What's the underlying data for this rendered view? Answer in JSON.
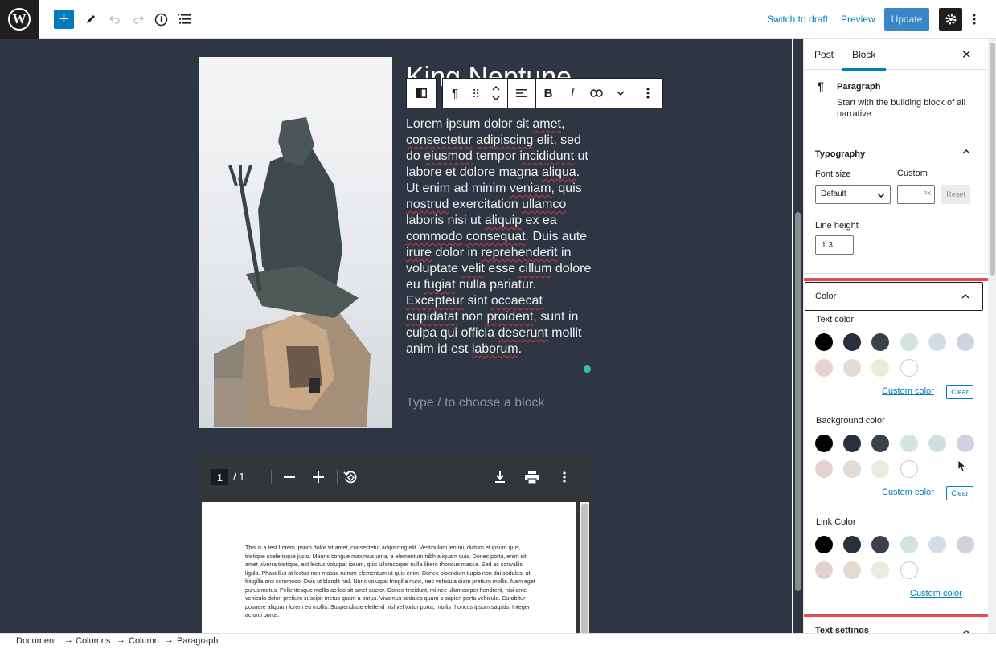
{
  "topbar": {
    "add_glyph": "+",
    "switch_to_draft": "Switch to draft",
    "preview": "Preview",
    "update": "Update"
  },
  "icons": {
    "logo": "wordpress-logo-icon",
    "tools": "pencil-icon",
    "undo": "undo-icon",
    "redo": "redo-icon",
    "details": "info-icon",
    "outline": "list-view-icon",
    "settings": "gear-icon",
    "options": "kebab-icon"
  },
  "editor": {
    "title": "King Neptune",
    "paragraph_parts": [
      {
        "t": "Lorem ipsum dolor sit ",
        "u": false
      },
      {
        "t": "amet",
        "u": true
      },
      {
        "t": ", ",
        "u": false
      },
      {
        "t": "consectetur",
        "u": true
      },
      {
        "t": " ",
        "u": false
      },
      {
        "t": "adipiscing",
        "u": true
      },
      {
        "t": " elit, sed do ",
        "u": false
      },
      {
        "t": "eiusmod",
        "u": true
      },
      {
        "t": " tempor ",
        "u": false
      },
      {
        "t": "incididunt",
        "u": true
      },
      {
        "t": " ut labore et dolore magna ",
        "u": false
      },
      {
        "t": "aliqua",
        "u": true
      },
      {
        "t": ". Ut enim ad minim ",
        "u": false
      },
      {
        "t": "veniam",
        "u": true
      },
      {
        "t": ", quis ",
        "u": false
      },
      {
        "t": "nostrud",
        "u": true
      },
      {
        "t": " exercitation ",
        "u": false
      },
      {
        "t": "ullamco",
        "u": true
      },
      {
        "t": " laboris nisi ut ",
        "u": false
      },
      {
        "t": "aliquip",
        "u": true
      },
      {
        "t": " ex ea ",
        "u": false
      },
      {
        "t": "commodo",
        "u": true
      },
      {
        "t": " ",
        "u": false
      },
      {
        "t": "consequat",
        "u": true
      },
      {
        "t": ". Duis aute ",
        "u": false
      },
      {
        "t": "irure",
        "u": true
      },
      {
        "t": " dolor in ",
        "u": false
      },
      {
        "t": "reprehenderit",
        "u": true
      },
      {
        "t": " in voluptate ",
        "u": false
      },
      {
        "t": "velit",
        "u": true
      },
      {
        "t": " esse ",
        "u": false
      },
      {
        "t": "cillum",
        "u": true
      },
      {
        "t": " dolore eu ",
        "u": false
      },
      {
        "t": "fugiat",
        "u": true
      },
      {
        "t": " nulla pariatur. ",
        "u": false
      },
      {
        "t": "Excepteur",
        "u": true
      },
      {
        "t": " sint ",
        "u": false
      },
      {
        "t": "occaecat",
        "u": true
      },
      {
        "t": " ",
        "u": false
      },
      {
        "t": "cupidatat",
        "u": true
      },
      {
        "t": " non ",
        "u": false
      },
      {
        "t": "proident",
        "u": true
      },
      {
        "t": ", sunt in culpa qui officia ",
        "u": false
      },
      {
        "t": "deserunt",
        "u": true
      },
      {
        "t": " mollit anim id est ",
        "u": false
      },
      {
        "t": "laborum",
        "u": true
      },
      {
        "t": ".",
        "u": false
      }
    ],
    "placeholder": "Type / to choose a block",
    "colors": {
      "canvas_bg": "#2f3643",
      "accent": "#007cba"
    }
  },
  "pdf": {
    "page_current": "1",
    "page_total": "/  1",
    "text": "This is a test Lorem ipsum dolor sit amet, consectetur adipiscing elit. Vestibulum leo mi, dictum et ipsum quis, tristique scelerisque justo. Mauris congue maximus urna, a elementum nibh aliquam quis. Donec porta, enim sit amet viverra tristique, est lectus volutpat ipsum, quis ullamcorper nulla libero rhoncus massa. Sed ac convallis ligula. Phasellus at lectus non massa rutrum elementum ut quis enim. Donec bibendum turpis non dui sodales, ut fringilla orci commodo. Duis ut blandit nisl. Nunc volutpat fringilla nunc, nec vehicula diam pretium mollis. Nam eget purus metus. Pellentesque mollis ac leo sit amet auctor. Donec tincidunt, mi nec ullamcorper hendrerit, nisi ante vehicula dolor, pretium suscipit metus quam a purus. Vivamus sodales quam a sapien porta vehicula. Curabitur posuere aliquam lorem eu mollis. Suspendisse eleifend nisl vel tortor porta, mollis rhoncus ipsum sagittis. Integer ac orci purus."
  },
  "sidebar": {
    "tab_post": "Post",
    "tab_block": "Block",
    "close": "✕",
    "block_card": {
      "title": "Paragraph",
      "description": "Start with the building block of all narrative."
    },
    "typography": {
      "title": "Typography",
      "font_size_label": "Font size",
      "custom_label": "Custom",
      "font_size_value": "Default",
      "unit": "PX",
      "reset": "Reset",
      "line_height_label": "Line height",
      "line_height_value": "1.3"
    },
    "color": {
      "title": "Color",
      "text_color_label": "Text color",
      "background_color_label": "Background color",
      "link_color_label": "Link Color",
      "custom_color": "Custom color",
      "clear": "Clear",
      "palette": [
        "#000000",
        "#28303d",
        "#39414d",
        "#d1e4dd",
        "#d1dfe4",
        "#d1d1e4",
        "#e4d1d1",
        "#e4dad1",
        "#eeeadd",
        "#ffffff"
      ]
    },
    "text_settings": "Text settings"
  },
  "footer": {
    "crumbs": [
      "Document",
      "Columns",
      "Column",
      "Paragraph"
    ]
  }
}
